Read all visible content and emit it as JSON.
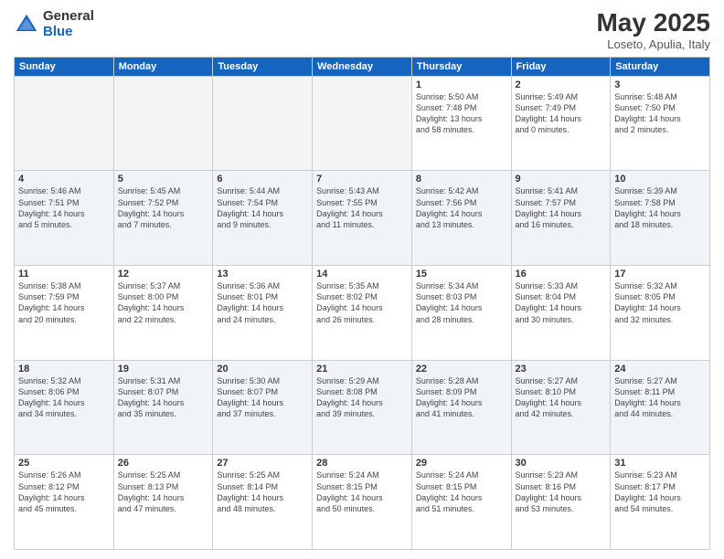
{
  "logo": {
    "general": "General",
    "blue": "Blue"
  },
  "header": {
    "month": "May 2025",
    "location": "Loseto, Apulia, Italy"
  },
  "days": [
    "Sunday",
    "Monday",
    "Tuesday",
    "Wednesday",
    "Thursday",
    "Friday",
    "Saturday"
  ],
  "weeks": [
    [
      {
        "num": "",
        "info": ""
      },
      {
        "num": "",
        "info": ""
      },
      {
        "num": "",
        "info": ""
      },
      {
        "num": "",
        "info": ""
      },
      {
        "num": "1",
        "info": "Sunrise: 5:50 AM\nSunset: 7:48 PM\nDaylight: 13 hours\nand 58 minutes."
      },
      {
        "num": "2",
        "info": "Sunrise: 5:49 AM\nSunset: 7:49 PM\nDaylight: 14 hours\nand 0 minutes."
      },
      {
        "num": "3",
        "info": "Sunrise: 5:48 AM\nSunset: 7:50 PM\nDaylight: 14 hours\nand 2 minutes."
      }
    ],
    [
      {
        "num": "4",
        "info": "Sunrise: 5:46 AM\nSunset: 7:51 PM\nDaylight: 14 hours\nand 5 minutes."
      },
      {
        "num": "5",
        "info": "Sunrise: 5:45 AM\nSunset: 7:52 PM\nDaylight: 14 hours\nand 7 minutes."
      },
      {
        "num": "6",
        "info": "Sunrise: 5:44 AM\nSunset: 7:54 PM\nDaylight: 14 hours\nand 9 minutes."
      },
      {
        "num": "7",
        "info": "Sunrise: 5:43 AM\nSunset: 7:55 PM\nDaylight: 14 hours\nand 11 minutes."
      },
      {
        "num": "8",
        "info": "Sunrise: 5:42 AM\nSunset: 7:56 PM\nDaylight: 14 hours\nand 13 minutes."
      },
      {
        "num": "9",
        "info": "Sunrise: 5:41 AM\nSunset: 7:57 PM\nDaylight: 14 hours\nand 16 minutes."
      },
      {
        "num": "10",
        "info": "Sunrise: 5:39 AM\nSunset: 7:58 PM\nDaylight: 14 hours\nand 18 minutes."
      }
    ],
    [
      {
        "num": "11",
        "info": "Sunrise: 5:38 AM\nSunset: 7:59 PM\nDaylight: 14 hours\nand 20 minutes."
      },
      {
        "num": "12",
        "info": "Sunrise: 5:37 AM\nSunset: 8:00 PM\nDaylight: 14 hours\nand 22 minutes."
      },
      {
        "num": "13",
        "info": "Sunrise: 5:36 AM\nSunset: 8:01 PM\nDaylight: 14 hours\nand 24 minutes."
      },
      {
        "num": "14",
        "info": "Sunrise: 5:35 AM\nSunset: 8:02 PM\nDaylight: 14 hours\nand 26 minutes."
      },
      {
        "num": "15",
        "info": "Sunrise: 5:34 AM\nSunset: 8:03 PM\nDaylight: 14 hours\nand 28 minutes."
      },
      {
        "num": "16",
        "info": "Sunrise: 5:33 AM\nSunset: 8:04 PM\nDaylight: 14 hours\nand 30 minutes."
      },
      {
        "num": "17",
        "info": "Sunrise: 5:32 AM\nSunset: 8:05 PM\nDaylight: 14 hours\nand 32 minutes."
      }
    ],
    [
      {
        "num": "18",
        "info": "Sunrise: 5:32 AM\nSunset: 8:06 PM\nDaylight: 14 hours\nand 34 minutes."
      },
      {
        "num": "19",
        "info": "Sunrise: 5:31 AM\nSunset: 8:07 PM\nDaylight: 14 hours\nand 35 minutes."
      },
      {
        "num": "20",
        "info": "Sunrise: 5:30 AM\nSunset: 8:07 PM\nDaylight: 14 hours\nand 37 minutes."
      },
      {
        "num": "21",
        "info": "Sunrise: 5:29 AM\nSunset: 8:08 PM\nDaylight: 14 hours\nand 39 minutes."
      },
      {
        "num": "22",
        "info": "Sunrise: 5:28 AM\nSunset: 8:09 PM\nDaylight: 14 hours\nand 41 minutes."
      },
      {
        "num": "23",
        "info": "Sunrise: 5:27 AM\nSunset: 8:10 PM\nDaylight: 14 hours\nand 42 minutes."
      },
      {
        "num": "24",
        "info": "Sunrise: 5:27 AM\nSunset: 8:11 PM\nDaylight: 14 hours\nand 44 minutes."
      }
    ],
    [
      {
        "num": "25",
        "info": "Sunrise: 5:26 AM\nSunset: 8:12 PM\nDaylight: 14 hours\nand 45 minutes."
      },
      {
        "num": "26",
        "info": "Sunrise: 5:25 AM\nSunset: 8:13 PM\nDaylight: 14 hours\nand 47 minutes."
      },
      {
        "num": "27",
        "info": "Sunrise: 5:25 AM\nSunset: 8:14 PM\nDaylight: 14 hours\nand 48 minutes."
      },
      {
        "num": "28",
        "info": "Sunrise: 5:24 AM\nSunset: 8:15 PM\nDaylight: 14 hours\nand 50 minutes."
      },
      {
        "num": "29",
        "info": "Sunrise: 5:24 AM\nSunset: 8:15 PM\nDaylight: 14 hours\nand 51 minutes."
      },
      {
        "num": "30",
        "info": "Sunrise: 5:23 AM\nSunset: 8:16 PM\nDaylight: 14 hours\nand 53 minutes."
      },
      {
        "num": "31",
        "info": "Sunrise: 5:23 AM\nSunset: 8:17 PM\nDaylight: 14 hours\nand 54 minutes."
      }
    ]
  ]
}
